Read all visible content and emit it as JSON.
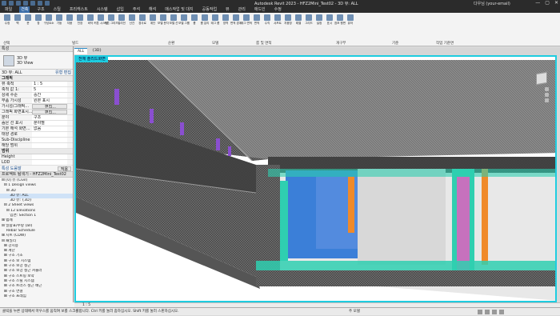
{
  "app": {
    "title": "Autodesk Revit 2023 - HFZ2Mini_Test02 - 3D 뷰: ALL",
    "user": "다우님 (your-email)",
    "window_controls": [
      "—",
      "▢",
      "✕"
    ]
  },
  "menu_tabs": [
    "파일",
    "건축",
    "구조",
    "스틸",
    "프리캐스트",
    "시스템",
    "삽입",
    "주석",
    "해석",
    "매스작업 및 대지",
    "공동작업",
    "뷰",
    "관리",
    "애드인",
    "수정"
  ],
  "active_tab_index": 1,
  "ribbon": {
    "tools": [
      "수정",
      "벽",
      "문",
      "창",
      "구성요소",
      "기둥",
      "지붕",
      "천장",
      "바닥",
      "커튼 시스템",
      "커튼 그리드",
      "멀리언",
      "난간",
      "경사로",
      "계단",
      "모델 문자",
      "모델 선",
      "모델 그룹",
      "룸",
      "룸 분리",
      "태그 룸",
      "영역",
      "면적 경계",
      "태그 면적",
      "면적",
      "수직",
      "샤프트",
      "지붕창",
      "레벨",
      "그리드",
      "설정",
      "표시",
      "참조 평면",
      "뷰어"
    ],
    "groups": [
      "선택",
      "빌드",
      "순환",
      "모델",
      "룸 및 면적",
      "개구부",
      "기준",
      "작업 기준면"
    ]
  },
  "properties": {
    "header": "특성",
    "type_name": "3D 뷰",
    "type_sub": "3D View",
    "filter_label": "3D 뷰: ALL",
    "edit_type": "유형 편집",
    "section_graphics": "그래픽",
    "rows": [
      {
        "k": "뷰 축척",
        "v": "1 : 5"
      },
      {
        "k": "축척 값 1:",
        "v": "5"
      },
      {
        "k": "상세 수준",
        "v": "중간"
      },
      {
        "k": "부품 가시성",
        "v": "원본 표시"
      },
      {
        "k": "가시성/그래픽...",
        "v": "편집...",
        "btn": true
      },
      {
        "k": "그래픽 화면표시...",
        "v": "편집...",
        "btn": true
      },
      {
        "k": "분야",
        "v": "구조"
      },
      {
        "k": "숨은 선 표시",
        "v": "분야별"
      },
      {
        "k": "기본 해석 화면...",
        "v": "없음"
      },
      {
        "k": "태양 경로",
        "v": "",
        "btn": false
      },
      {
        "k": "Sub-Discipline",
        "v": ""
      },
      {
        "k": "해당 범위",
        "v": ""
      }
    ],
    "section_extents": "범위",
    "rows2": [
      {
        "k": "Height",
        "v": ""
      },
      {
        "k": "LOD",
        "v": ""
      }
    ],
    "help_link": "특성 도움말",
    "apply": "적용"
  },
  "browser": {
    "header": "프로젝트 탐색기 - HFZ2Mini_Test02",
    "items": [
      "⊟ [0] 뷰 (Civil)",
      "  ⊟ 1 Design views",
      "    ⊟ 3D",
      "       3D 뷰: ALL",
      "       3D 뷰: {3D}",
      "  ⊟ 2 Sheet views",
      "    ⊟ 12 Elevations",
      "       입면: Section 1",
      "⊞ 범례",
      "⊟ 일람표/수량 (all)",
      "    Rebar Schedule",
      "⊞ 시트 (CDW)",
      "⊟ 패밀리",
      "  ⊞ 강시용",
      "  ⊞ 계단",
      "  ⊞ 구조 기초",
      "  ⊞ 구조 보 시스템",
      "  ⊞ 구조 보강 철근",
      "  ⊞ 구조 보강 철근 커플러",
      "  ⊞ 구조 스트링 보약",
      "  ⊞ 구조 스틸 시스템",
      "  ⊞ 구조 트러스 철근 배근",
      "  ⊞ 구조 연결",
      "  ⊞ 구조 프레임"
    ],
    "selected_index": 3
  },
  "view_tabs": [
    {
      "label": "ALL",
      "active": true
    },
    {
      "label": "{3D}",
      "active": false
    }
  ],
  "viewport": {
    "title": "전체 솔리드화면",
    "scale": "1 : 5"
  },
  "status": {
    "message": "클릭을 누른 상태에서 마우스를 움직여 보를 스크롤합니다. Ctrl 키를 눌러 줌하십시오. Shift 키를 눌러 스핀하십시오.",
    "model": "주 모델"
  }
}
